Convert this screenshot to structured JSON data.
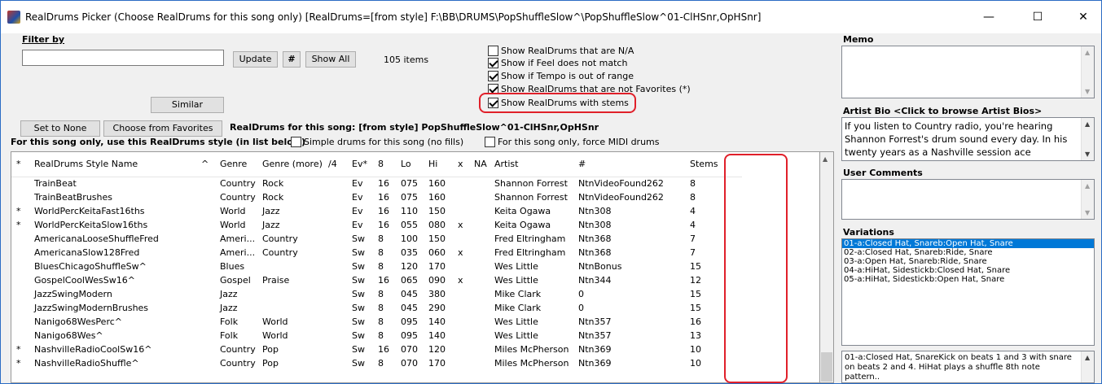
{
  "window": {
    "title": "RealDrums Picker (Choose RealDrums for this song only)  [RealDrums=[from style] F:\\BB\\DRUMS\\PopShuffleSlow^\\PopShuffleSlow^01-ClHSnr,OpHSnr]",
    "minimize_glyph": "—",
    "maximize_glyph": "☐",
    "close_glyph": "✕"
  },
  "filter": {
    "label": "Filter by",
    "search_value": "",
    "update_label": "Update",
    "hash_label": "#",
    "show_all_label": "Show All",
    "items_count": "105 items",
    "similar_label": "Similar"
  },
  "options": [
    {
      "label": "Show RealDrums that are N/A",
      "checked": false
    },
    {
      "label": "Show if Feel does not match",
      "checked": true
    },
    {
      "label": "Show if Tempo is out of range",
      "checked": true
    },
    {
      "label": "Show RealDrums that are not Favorites (*)",
      "checked": true
    },
    {
      "label": "Show RealDrums with stems",
      "checked": true
    }
  ],
  "actions": {
    "set_to_none": "Set to None",
    "choose_from_favorites": "Choose from Favorites",
    "current_label": "RealDrums for this song: [from style] PopShuffleSlow^01-ClHSnr,OpHSnr",
    "use_style_label": "For this song only, use this RealDrums style (in list below)",
    "simple_drums_label": "Simple drums for this song (no fills)",
    "force_midi_label": "For this song only, force MIDI drums"
  },
  "table": {
    "headers": [
      "*",
      "RealDrums Style Name",
      "^",
      "Genre",
      "Genre (more)",
      "/4",
      "Ev*",
      "8",
      "Lo",
      "Hi",
      "x",
      "NA",
      "Artist",
      "#",
      "Stems"
    ],
    "rows": [
      [
        "",
        "TrainBeat",
        "",
        "Country",
        "Rock",
        "",
        "Ev",
        "16",
        "075",
        "160",
        "",
        "",
        "Shannon Forrest",
        "NtnVideoFound262",
        "8"
      ],
      [
        "",
        "TrainBeatBrushes",
        "",
        "Country",
        "Rock",
        "",
        "Ev",
        "16",
        "075",
        "160",
        "",
        "",
        "Shannon Forrest",
        "NtnVideoFound262",
        "8"
      ],
      [
        "*",
        "WorldPercKeitaFast16ths",
        "",
        "World",
        "Jazz",
        "",
        "Ev",
        "16",
        "110",
        "150",
        "",
        "",
        "Keita Ogawa",
        "Ntn308",
        "4"
      ],
      [
        "*",
        "WorldPercKeitaSlow16ths",
        "",
        "World",
        "Jazz",
        "",
        "Ev",
        "16",
        "055",
        "080",
        "x",
        "",
        "Keita Ogawa",
        "Ntn308",
        "4"
      ],
      [
        "",
        "AmericanaLooseShuffleFred",
        "",
        "Ameri...",
        "Country",
        "",
        "Sw",
        "8",
        "100",
        "150",
        "",
        "",
        "Fred Eltringham",
        "Ntn368",
        "7"
      ],
      [
        "",
        "AmericanaSlow128Fred",
        "",
        "Ameri...",
        "Country",
        "",
        "Sw",
        "8",
        "035",
        "060",
        "x",
        "",
        "Fred Eltringham",
        "Ntn368",
        "7"
      ],
      [
        "",
        "BluesChicagoShuffleSw^",
        "",
        "Blues",
        "",
        "",
        "Sw",
        "8",
        "120",
        "170",
        "",
        "",
        "Wes Little",
        "NtnBonus",
        "15"
      ],
      [
        "",
        "GospelCoolWesSw16^",
        "",
        "Gospel",
        "Praise",
        "",
        "Sw",
        "16",
        "065",
        "090",
        "x",
        "",
        "Wes Little",
        "Ntn344",
        "12"
      ],
      [
        "",
        "JazzSwingModern",
        "",
        "Jazz",
        "",
        "",
        "Sw",
        "8",
        "045",
        "380",
        "",
        "",
        "Mike Clark",
        "0",
        "15"
      ],
      [
        "",
        "JazzSwingModernBrushes",
        "",
        "Jazz",
        "",
        "",
        "Sw",
        "8",
        "045",
        "290",
        "",
        "",
        "Mike Clark",
        "0",
        "15"
      ],
      [
        "",
        "Nanigo68WesPerc^",
        "",
        "Folk",
        "World",
        "",
        "Sw",
        "8",
        "095",
        "140",
        "",
        "",
        "Wes Little",
        "Ntn357",
        "16"
      ],
      [
        "",
        "Nanigo68Wes^",
        "",
        "Folk",
        "World",
        "",
        "Sw",
        "8",
        "095",
        "140",
        "",
        "",
        "Wes Little",
        "Ntn357",
        "13"
      ],
      [
        "*",
        "NashvilleRadioCoolSw16^",
        "",
        "Country",
        "Pop",
        "",
        "Sw",
        "16",
        "070",
        "120",
        "",
        "",
        "Miles McPherson",
        "Ntn369",
        "10"
      ],
      [
        "*",
        "NashvilleRadioShuffle^",
        "",
        "Country",
        "Pop",
        "",
        "Sw",
        "8",
        "070",
        "170",
        "",
        "",
        "Miles McPherson",
        "Ntn369",
        "10"
      ]
    ]
  },
  "memo": {
    "label": "Memo",
    "text": ""
  },
  "artist_bio": {
    "label": "Artist Bio  <Click to browse Artist Bios>",
    "text": "If you listen to Country radio, you're hearing Shannon Forrest's drum sound every day. In his twenty years as a Nashville session ace"
  },
  "user_comments": {
    "label": "User Comments",
    "text": ""
  },
  "variations": {
    "label": "Variations",
    "items": [
      "01-a:Closed Hat, Snareb:Open Hat, Snare",
      "02-a:Closed Hat, Snareb:Ride, Snare",
      "03-a:Open Hat, Snareb:Ride, Snare",
      "04-a:HiHat, Sidestickb:Closed Hat, Snare",
      "05-a:HiHat, Sidestickb:Open Hat, Snare"
    ],
    "description": "01-a:Closed Hat, SnareKick on beats 1 and 3 with snare on beats 2 and 4. HiHat plays a shuffle 8th note pattern.."
  },
  "colors": {
    "accent": "#0078d7",
    "highlight_ring": "#e0202a"
  }
}
